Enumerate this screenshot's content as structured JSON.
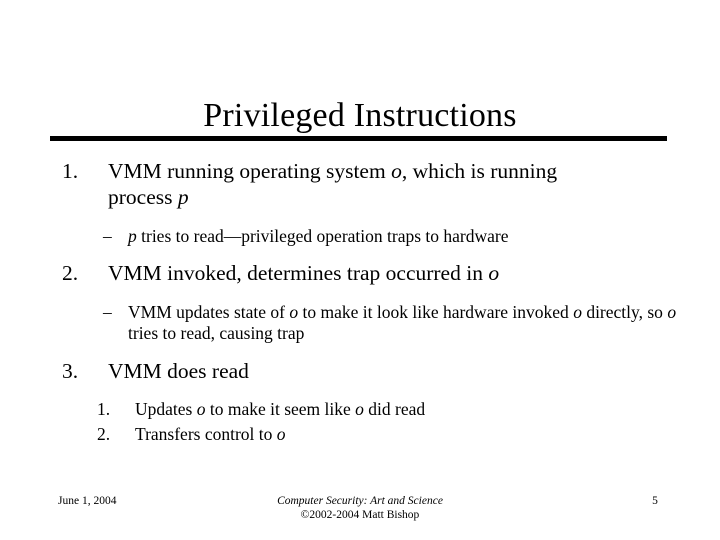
{
  "slide": {
    "title": "Privileged Instructions",
    "page_number": "5",
    "background_color": "#ffffff",
    "text_color": "#000000",
    "rule_color": "#000000"
  },
  "content": {
    "items": [
      {
        "marker": "1.",
        "text_parts": [
          {
            "t": "VMM running operating system ",
            "style": "normal"
          },
          {
            "t": "o",
            "style": "italic"
          },
          {
            "t": ", which is running process ",
            "style": "normal"
          },
          {
            "t": "p",
            "style": "italic"
          }
        ]
      },
      {
        "marker": "–",
        "text_parts": [
          {
            "t": "p",
            "style": "italic"
          },
          {
            "t": " tries to read—privileged operation traps to hardware",
            "style": "normal"
          }
        ]
      },
      {
        "marker": "2.",
        "text_parts": [
          {
            "t": "VMM invoked, determines trap occurred in ",
            "style": "normal"
          },
          {
            "t": "o",
            "style": "italic"
          }
        ]
      },
      {
        "marker": "–",
        "text_parts": [
          {
            "t": "VMM updates state of ",
            "style": "normal"
          },
          {
            "t": "o",
            "style": "italic"
          },
          {
            "t": " to make it look like hardware invoked ",
            "style": "normal"
          },
          {
            "t": "o",
            "style": "italic"
          },
          {
            "t": " directly, so ",
            "style": "normal"
          },
          {
            "t": "o",
            "style": "italic"
          },
          {
            "t": " tries to read, causing trap",
            "style": "normal"
          }
        ]
      },
      {
        "marker": "3.",
        "text_parts": [
          {
            "t": "VMM does read",
            "style": "normal"
          }
        ]
      },
      {
        "marker": "1.",
        "text_parts": [
          {
            "t": "Updates ",
            "style": "normal"
          },
          {
            "t": "o",
            "style": "italic"
          },
          {
            "t": " to make it seem like ",
            "style": "normal"
          },
          {
            "t": "o",
            "style": "italic"
          },
          {
            "t": " did read",
            "style": "normal"
          }
        ]
      },
      {
        "marker": "2.",
        "text_parts": [
          {
            "t": "Transfers control to ",
            "style": "normal"
          },
          {
            "t": "o",
            "style": "italic"
          }
        ]
      }
    ]
  },
  "footer": {
    "date": "June 1, 2004",
    "source_title": "Computer Security: Art and Science",
    "copyright": "©2002-2004 Matt Bishop",
    "page": "5"
  }
}
